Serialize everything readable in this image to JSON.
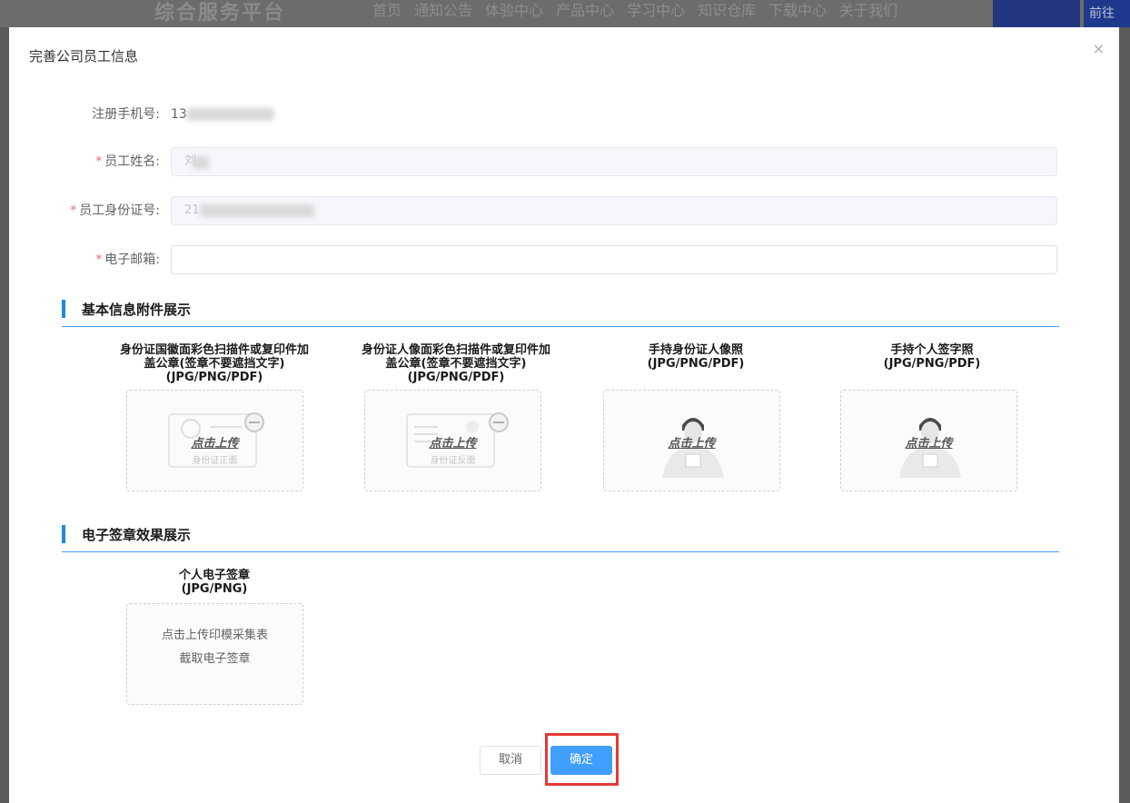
{
  "background": {
    "logo": "综合服务平台",
    "nav": [
      "首页",
      "通知公告",
      "体验中心",
      "产品中心",
      "学习中心",
      "知识仓库",
      "下载中心",
      "关于我们"
    ],
    "go_button": "前往"
  },
  "modal": {
    "title": "完善公司员工信息",
    "close_icon": "×"
  },
  "form": {
    "phone_label": "注册手机号:",
    "phone_value": "13",
    "name_label": "员工姓名:",
    "name_value": "刘",
    "idcard_label": "员工身份证号:",
    "idcard_value": "21",
    "email_label": "电子邮箱:",
    "email_value": "",
    "required_mark": "*"
  },
  "section_attachments": {
    "title": "基本信息附件展示",
    "items": [
      {
        "caption_line1": "身份证国徽面彩色扫描件或复印件加",
        "caption_line2": "盖公章(签章不要遮挡文字)",
        "caption_line3": "(JPG/PNG/PDF)",
        "upload_text": "点击上传",
        "sub_text": "身份证正面"
      },
      {
        "caption_line1": "身份证人像面彩色扫描件或复印件加",
        "caption_line2": "盖公章(签章不要遮挡文字)",
        "caption_line3": "(JPG/PNG/PDF)",
        "upload_text": "点击上传",
        "sub_text": "身份证反面"
      },
      {
        "caption_line1": "手持身份证人像照",
        "caption_line2": "(JPG/PNG/PDF)",
        "caption_line3": "",
        "upload_text": "点击上传",
        "sub_text": ""
      },
      {
        "caption_line1": "手持个人签字照",
        "caption_line2": "(JPG/PNG/PDF)",
        "caption_line3": "",
        "upload_text": "点击上传",
        "sub_text": ""
      }
    ]
  },
  "section_seal": {
    "title": "电子签章效果展示",
    "caption_line1": "个人电子签章",
    "caption_line2": "(JPG/PNG)",
    "box_line1": "点击上传印模采集表",
    "box_line2": "截取电子签章"
  },
  "footer": {
    "cancel_label": "取消",
    "ok_label": "确定"
  },
  "colors": {
    "primary": "#409eff",
    "section_bar": "#1e88e5",
    "required": "#f56c6c",
    "highlight": "#e53935"
  }
}
